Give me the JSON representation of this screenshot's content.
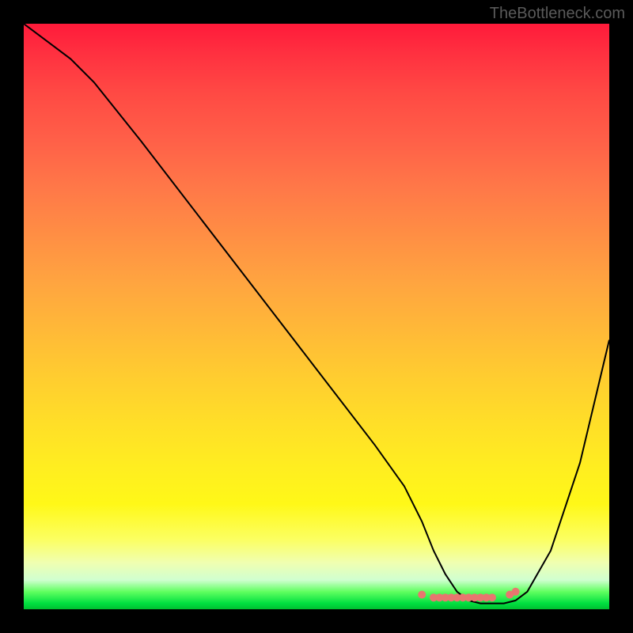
{
  "watermark": "TheBottleneck.com",
  "chart_data": {
    "type": "line",
    "title": "",
    "xlabel": "",
    "ylabel": "",
    "xlim": [
      0,
      100
    ],
    "ylim": [
      0,
      100
    ],
    "series": [
      {
        "name": "curve",
        "x": [
          0,
          4,
          8,
          12,
          20,
          30,
          40,
          50,
          60,
          65,
          68,
          70,
          72,
          74,
          76,
          78,
          80,
          82,
          84,
          86,
          90,
          95,
          100
        ],
        "y": [
          100,
          97,
          94,
          90,
          80,
          67,
          54,
          41,
          28,
          21,
          15,
          10,
          6,
          3,
          1.5,
          1,
          1,
          1,
          1.5,
          3,
          10,
          25,
          46
        ]
      }
    ],
    "markers": {
      "x": [
        68,
        70,
        71,
        72,
        73,
        74,
        75,
        76,
        77,
        78,
        79,
        80,
        83,
        84
      ],
      "y": [
        2.5,
        2,
        2,
        2,
        2,
        2,
        2,
        2,
        2,
        2,
        2,
        2,
        2.5,
        3
      ],
      "color": "#e8766f"
    },
    "gradient_colors": {
      "top": "#ff1a3a",
      "middle": "#ffcc30",
      "bottom": "#00c030"
    }
  }
}
